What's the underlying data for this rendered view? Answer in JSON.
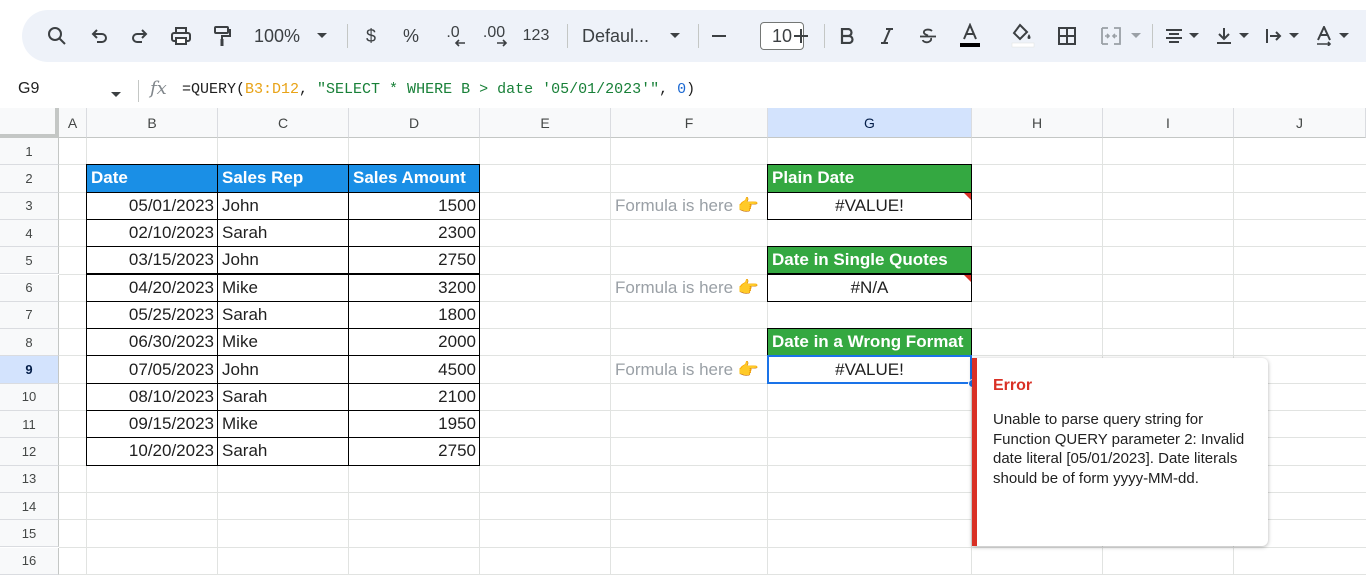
{
  "toolbar": {
    "zoom": "100%",
    "currency": "$",
    "percent": "%",
    "decrease_decimal": ".0",
    "increase_decimal": ".00",
    "number_format": "123",
    "font": "Defaul...",
    "font_size": "10",
    "icons": [
      "search-icon",
      "undo-icon",
      "redo-icon",
      "print-icon",
      "paint-format-icon",
      "bold-icon",
      "italic-icon",
      "strikethrough-icon",
      "text-color-icon",
      "fill-color-icon",
      "borders-icon",
      "merge-icon",
      "align-icon",
      "valign-icon",
      "text-wrap-icon",
      "text-rotation-icon"
    ]
  },
  "formula_bar": {
    "name_box": "G9",
    "fx": "fx",
    "formula_prefix": "=QUERY(",
    "formula_range": "B3:D12",
    "formula_comma1": ", ",
    "formula_string": "\"SELECT * WHERE B > date '05/01/2023'\"",
    "formula_comma2": ", ",
    "formula_number": "0",
    "formula_suffix": ")"
  },
  "columns": [
    "A",
    "B",
    "C",
    "D",
    "E",
    "F",
    "G",
    "H",
    "I",
    "J"
  ],
  "rows": [
    "1",
    "2",
    "3",
    "4",
    "5",
    "6",
    "7",
    "8",
    "9",
    "10",
    "11",
    "12",
    "13",
    "14",
    "15",
    "16"
  ],
  "table": {
    "headers": [
      "Date",
      "Sales Rep",
      "Sales Amount"
    ],
    "rows": [
      [
        "05/01/2023",
        "John",
        "1500"
      ],
      [
        "02/10/2023",
        "Sarah",
        "2300"
      ],
      [
        "03/15/2023",
        "John",
        "2750"
      ],
      [
        "04/20/2023",
        "Mike",
        "3200"
      ],
      [
        "05/25/2023",
        "Sarah",
        "1800"
      ],
      [
        "06/30/2023",
        "Mike",
        "2000"
      ],
      [
        "07/05/2023",
        "John",
        "4500"
      ],
      [
        "08/10/2023",
        "Sarah",
        "2100"
      ],
      [
        "09/15/2023",
        "Mike",
        "1950"
      ],
      [
        "10/20/2023",
        "Sarah",
        "2750"
      ]
    ]
  },
  "notes": {
    "formula_here": "Formula is here 👉"
  },
  "cases": [
    {
      "title": "Plain Date",
      "result": "#VALUE!"
    },
    {
      "title": "Date in Single Quotes",
      "result": "#N/A"
    },
    {
      "title": "Date in a Wrong Format",
      "result": "#VALUE!"
    }
  ],
  "colors": {
    "header_blue": "#1a8fe6",
    "header_green": "#34a841",
    "error_red": "#d93025",
    "selection_blue": "#1a73e8"
  },
  "error_popup": {
    "title": "Error",
    "message": "Unable to parse query string for Function QUERY parameter 2: Invalid date literal [05/01/2023]. Date literals should be of form yyyy-MM-dd."
  }
}
